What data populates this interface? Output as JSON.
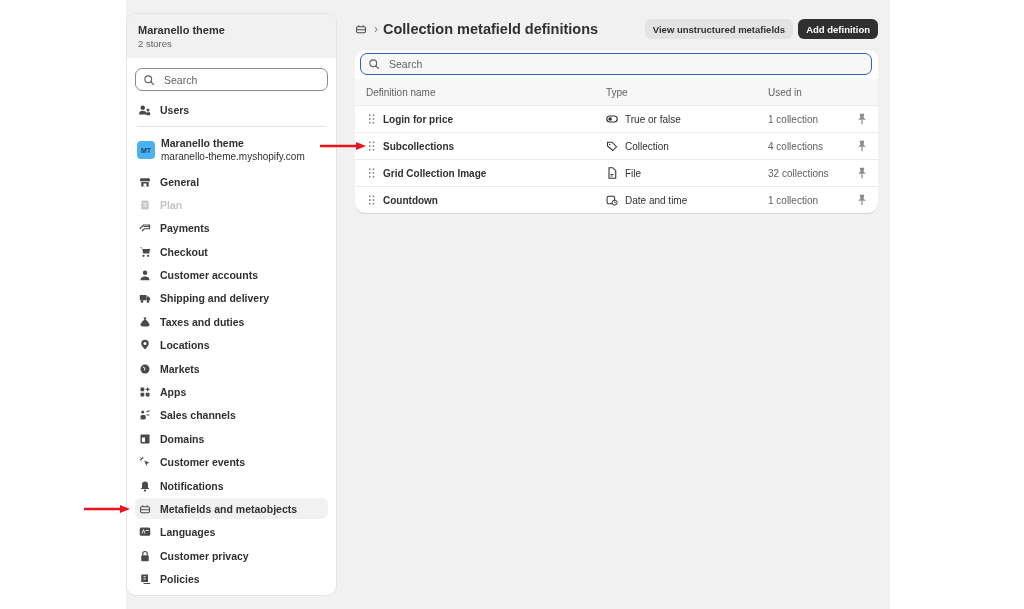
{
  "sidebar": {
    "store_switcher": {
      "name": "Maranello theme",
      "subtitle": "2 stores"
    },
    "search": {
      "placeholder": "Search"
    },
    "users": {
      "label": "Users"
    },
    "store": {
      "initials": "MT",
      "name": "Maranello theme",
      "domain": "maranello-theme.myshopify.com"
    },
    "items": [
      {
        "label": "General",
        "selected": false,
        "disabled": false,
        "arrow": false
      },
      {
        "label": "Plan",
        "selected": false,
        "disabled": true,
        "arrow": false
      },
      {
        "label": "Payments",
        "selected": false,
        "disabled": false,
        "arrow": false
      },
      {
        "label": "Checkout",
        "selected": false,
        "disabled": false,
        "arrow": false
      },
      {
        "label": "Customer accounts",
        "selected": false,
        "disabled": false,
        "arrow": false
      },
      {
        "label": "Shipping and delivery",
        "selected": false,
        "disabled": false,
        "arrow": false
      },
      {
        "label": "Taxes and duties",
        "selected": false,
        "disabled": false,
        "arrow": false
      },
      {
        "label": "Locations",
        "selected": false,
        "disabled": false,
        "arrow": false
      },
      {
        "label": "Markets",
        "selected": false,
        "disabled": false,
        "arrow": false
      },
      {
        "label": "Apps",
        "selected": false,
        "disabled": false,
        "arrow": false
      },
      {
        "label": "Sales channels",
        "selected": false,
        "disabled": false,
        "arrow": false
      },
      {
        "label": "Domains",
        "selected": false,
        "disabled": false,
        "arrow": false
      },
      {
        "label": "Customer events",
        "selected": false,
        "disabled": false,
        "arrow": false
      },
      {
        "label": "Notifications",
        "selected": false,
        "disabled": false,
        "arrow": false
      },
      {
        "label": "Metafields and metaobjects",
        "selected": true,
        "disabled": false,
        "arrow": true
      },
      {
        "label": "Languages",
        "selected": false,
        "disabled": false,
        "arrow": false
      },
      {
        "label": "Customer privacy",
        "selected": false,
        "disabled": false,
        "arrow": false
      },
      {
        "label": "Policies",
        "selected": false,
        "disabled": false,
        "arrow": false
      }
    ]
  },
  "header": {
    "separator": "›",
    "title": "Collection metafield definitions",
    "buttons": [
      {
        "label": "View unstructured metafields",
        "kind": "secondary"
      },
      {
        "label": "Add definition",
        "kind": "primary"
      }
    ]
  },
  "table": {
    "search": {
      "placeholder": "Search"
    },
    "columns": [
      "Definition name",
      "Type",
      "Used in"
    ],
    "rows": [
      {
        "name": "Login for price",
        "type": "True or false",
        "kind": "toggle",
        "used_in": "1 collection",
        "arrow": false
      },
      {
        "name": "Subcollections",
        "type": "Collection",
        "kind": "collection",
        "used_in": "4 collections",
        "arrow": true
      },
      {
        "name": "Grid Collection Image",
        "type": "File",
        "kind": "file",
        "used_in": "32 collections",
        "arrow": false
      },
      {
        "name": "Countdown",
        "type": "Date and time",
        "kind": "date",
        "used_in": "1 collection",
        "arrow": false
      }
    ]
  }
}
